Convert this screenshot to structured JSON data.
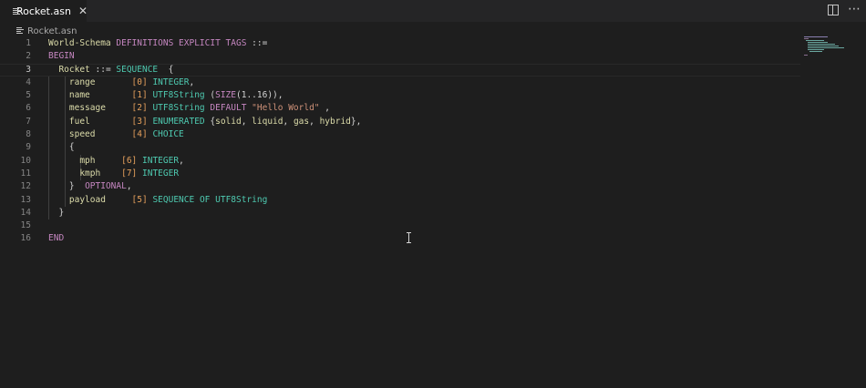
{
  "tab": {
    "label": "Rocket.asn",
    "close": "✕"
  },
  "breadcrumb": {
    "file": "Rocket.asn"
  },
  "editor": {
    "active_line": 3,
    "lines": [
      {
        "n": "1",
        "tokens": [
          {
            "t": "World-Schema",
            "c": "enum"
          },
          {
            "t": " "
          },
          {
            "t": "DEFINITIONS",
            "c": "kw"
          },
          {
            "t": " "
          },
          {
            "t": "EXPLICIT",
            "c": "kw"
          },
          {
            "t": " "
          },
          {
            "t": "TAGS",
            "c": "kw"
          },
          {
            "t": " ::=",
            "c": "op"
          }
        ]
      },
      {
        "n": "2",
        "tokens": [
          {
            "t": "BEGIN",
            "c": "kw"
          }
        ]
      },
      {
        "n": "3",
        "tokens": [
          {
            "t": "  "
          },
          {
            "t": "Rocket",
            "c": "enum"
          },
          {
            "t": " ::= ",
            "c": "op"
          },
          {
            "t": "SEQUENCE",
            "c": "ty"
          },
          {
            "t": "  {",
            "c": "p"
          }
        ]
      },
      {
        "n": "4",
        "tokens": [
          {
            "t": "    "
          },
          {
            "t": "range",
            "c": "enum"
          },
          {
            "t": "       "
          },
          {
            "t": "[0]",
            "c": "tag"
          },
          {
            "t": " "
          },
          {
            "t": "INTEGER",
            "c": "ty"
          },
          {
            "t": ",",
            "c": "p"
          }
        ]
      },
      {
        "n": "5",
        "tokens": [
          {
            "t": "    "
          },
          {
            "t": "name",
            "c": "enum"
          },
          {
            "t": "        "
          },
          {
            "t": "[1]",
            "c": "tag"
          },
          {
            "t": " "
          },
          {
            "t": "UTF8String",
            "c": "ty"
          },
          {
            "t": " (",
            "c": "p"
          },
          {
            "t": "SIZE",
            "c": "kw"
          },
          {
            "t": "(1..16)),",
            "c": "p"
          }
        ]
      },
      {
        "n": "6",
        "tokens": [
          {
            "t": "    "
          },
          {
            "t": "message",
            "c": "enum"
          },
          {
            "t": "     "
          },
          {
            "t": "[2]",
            "c": "tag"
          },
          {
            "t": " "
          },
          {
            "t": "UTF8String",
            "c": "ty"
          },
          {
            "t": " "
          },
          {
            "t": "DEFAULT",
            "c": "kw"
          },
          {
            "t": " "
          },
          {
            "t": "\"Hello World\"",
            "c": "str"
          },
          {
            "t": " ,",
            "c": "p"
          }
        ]
      },
      {
        "n": "7",
        "tokens": [
          {
            "t": "    "
          },
          {
            "t": "fuel",
            "c": "enum"
          },
          {
            "t": "        "
          },
          {
            "t": "[3]",
            "c": "tag"
          },
          {
            "t": " "
          },
          {
            "t": "ENUMERATED",
            "c": "ty"
          },
          {
            "t": " {",
            "c": "p"
          },
          {
            "t": "solid",
            "c": "enum"
          },
          {
            "t": ", ",
            "c": "p"
          },
          {
            "t": "liquid",
            "c": "enum"
          },
          {
            "t": ", ",
            "c": "p"
          },
          {
            "t": "gas",
            "c": "enum"
          },
          {
            "t": ", ",
            "c": "p"
          },
          {
            "t": "hybrid",
            "c": "enum"
          },
          {
            "t": "},",
            "c": "p"
          }
        ]
      },
      {
        "n": "8",
        "tokens": [
          {
            "t": "    "
          },
          {
            "t": "speed",
            "c": "enum"
          },
          {
            "t": "       "
          },
          {
            "t": "[4]",
            "c": "tag"
          },
          {
            "t": " "
          },
          {
            "t": "CHOICE",
            "c": "ty"
          }
        ]
      },
      {
        "n": "9",
        "tokens": [
          {
            "t": "    "
          },
          {
            "t": "{",
            "c": "p"
          }
        ]
      },
      {
        "n": "10",
        "tokens": [
          {
            "t": "      "
          },
          {
            "t": "mph",
            "c": "enum"
          },
          {
            "t": "     "
          },
          {
            "t": "[6]",
            "c": "tag"
          },
          {
            "t": " "
          },
          {
            "t": "INTEGER",
            "c": "ty"
          },
          {
            "t": ",",
            "c": "p"
          }
        ]
      },
      {
        "n": "11",
        "tokens": [
          {
            "t": "      "
          },
          {
            "t": "kmph",
            "c": "enum"
          },
          {
            "t": "    "
          },
          {
            "t": "[7]",
            "c": "tag"
          },
          {
            "t": " "
          },
          {
            "t": "INTEGER",
            "c": "ty"
          }
        ]
      },
      {
        "n": "12",
        "tokens": [
          {
            "t": "    "
          },
          {
            "t": "}",
            "c": "p"
          },
          {
            "t": "  "
          },
          {
            "t": "OPTIONAL",
            "c": "kw"
          },
          {
            "t": ",",
            "c": "p"
          }
        ]
      },
      {
        "n": "13",
        "tokens": [
          {
            "t": "    "
          },
          {
            "t": "payload",
            "c": "enum"
          },
          {
            "t": "     "
          },
          {
            "t": "[5]",
            "c": "tag"
          },
          {
            "t": " "
          },
          {
            "t": "SEQUENCE",
            "c": "ty"
          },
          {
            "t": " "
          },
          {
            "t": "OF",
            "c": "ty"
          },
          {
            "t": " "
          },
          {
            "t": "UTF8String",
            "c": "ty"
          }
        ]
      },
      {
        "n": "14",
        "tokens": [
          {
            "t": "  "
          },
          {
            "t": "}",
            "c": "p"
          }
        ]
      },
      {
        "n": "15",
        "tokens": []
      },
      {
        "n": "16",
        "tokens": [
          {
            "t": "END",
            "c": "kw"
          }
        ]
      }
    ]
  },
  "icons": {
    "file": "file-lines-icon",
    "split": "split-editor-icon",
    "more": "more-actions-icon",
    "cursor": "text-cursor-icon"
  },
  "colors": {
    "background": "#1e1e1e",
    "tabbar": "#252526",
    "keyword": "#c586c0",
    "type": "#4ec9b0",
    "identifier": "#dcdcaa",
    "tag": "#e5a05c",
    "string": "#ce9178"
  }
}
